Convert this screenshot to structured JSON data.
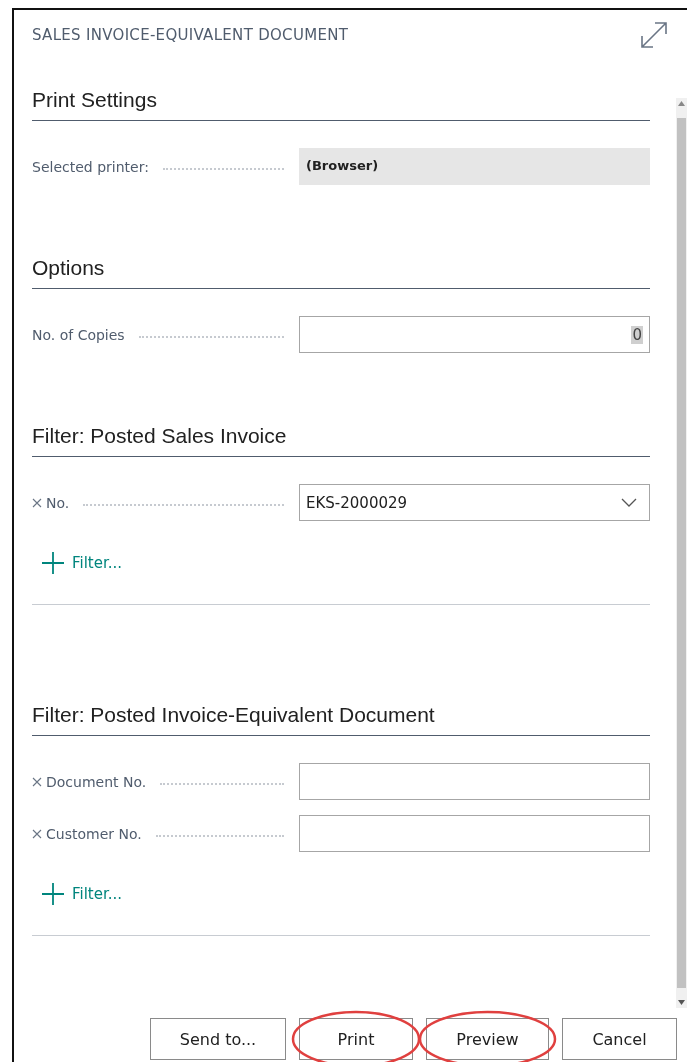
{
  "window": {
    "title": "SALES INVOICE-EQUIVALENT DOCUMENT"
  },
  "sections": [
    {
      "heading": "Print Settings",
      "rows": [
        {
          "label": "Selected printer:",
          "kind": "readonly",
          "value": "(Browser)",
          "removable": false
        }
      ]
    },
    {
      "heading": "Options",
      "rows": [
        {
          "label": "No. of Copies",
          "kind": "number",
          "value": "0",
          "removable": false
        }
      ]
    },
    {
      "heading": "Filter: Posted Sales Invoice",
      "rows": [
        {
          "label": "No.",
          "kind": "dropdown",
          "value": "EKS-2000029",
          "removable": true
        }
      ],
      "add_filter": "Filter..."
    },
    {
      "heading": "Filter: Posted Invoice-Equivalent Document",
      "rows": [
        {
          "label": "Document No.",
          "kind": "text",
          "value": "",
          "removable": true
        },
        {
          "label": "Customer No.",
          "kind": "text",
          "value": "",
          "removable": true
        }
      ],
      "add_filter": "Filter..."
    }
  ],
  "buttons": [
    {
      "label": "Send to...",
      "circled": false
    },
    {
      "label": "Print",
      "circled": true
    },
    {
      "label": "Preview",
      "circled": true
    },
    {
      "label": "Cancel",
      "circled": false
    }
  ]
}
